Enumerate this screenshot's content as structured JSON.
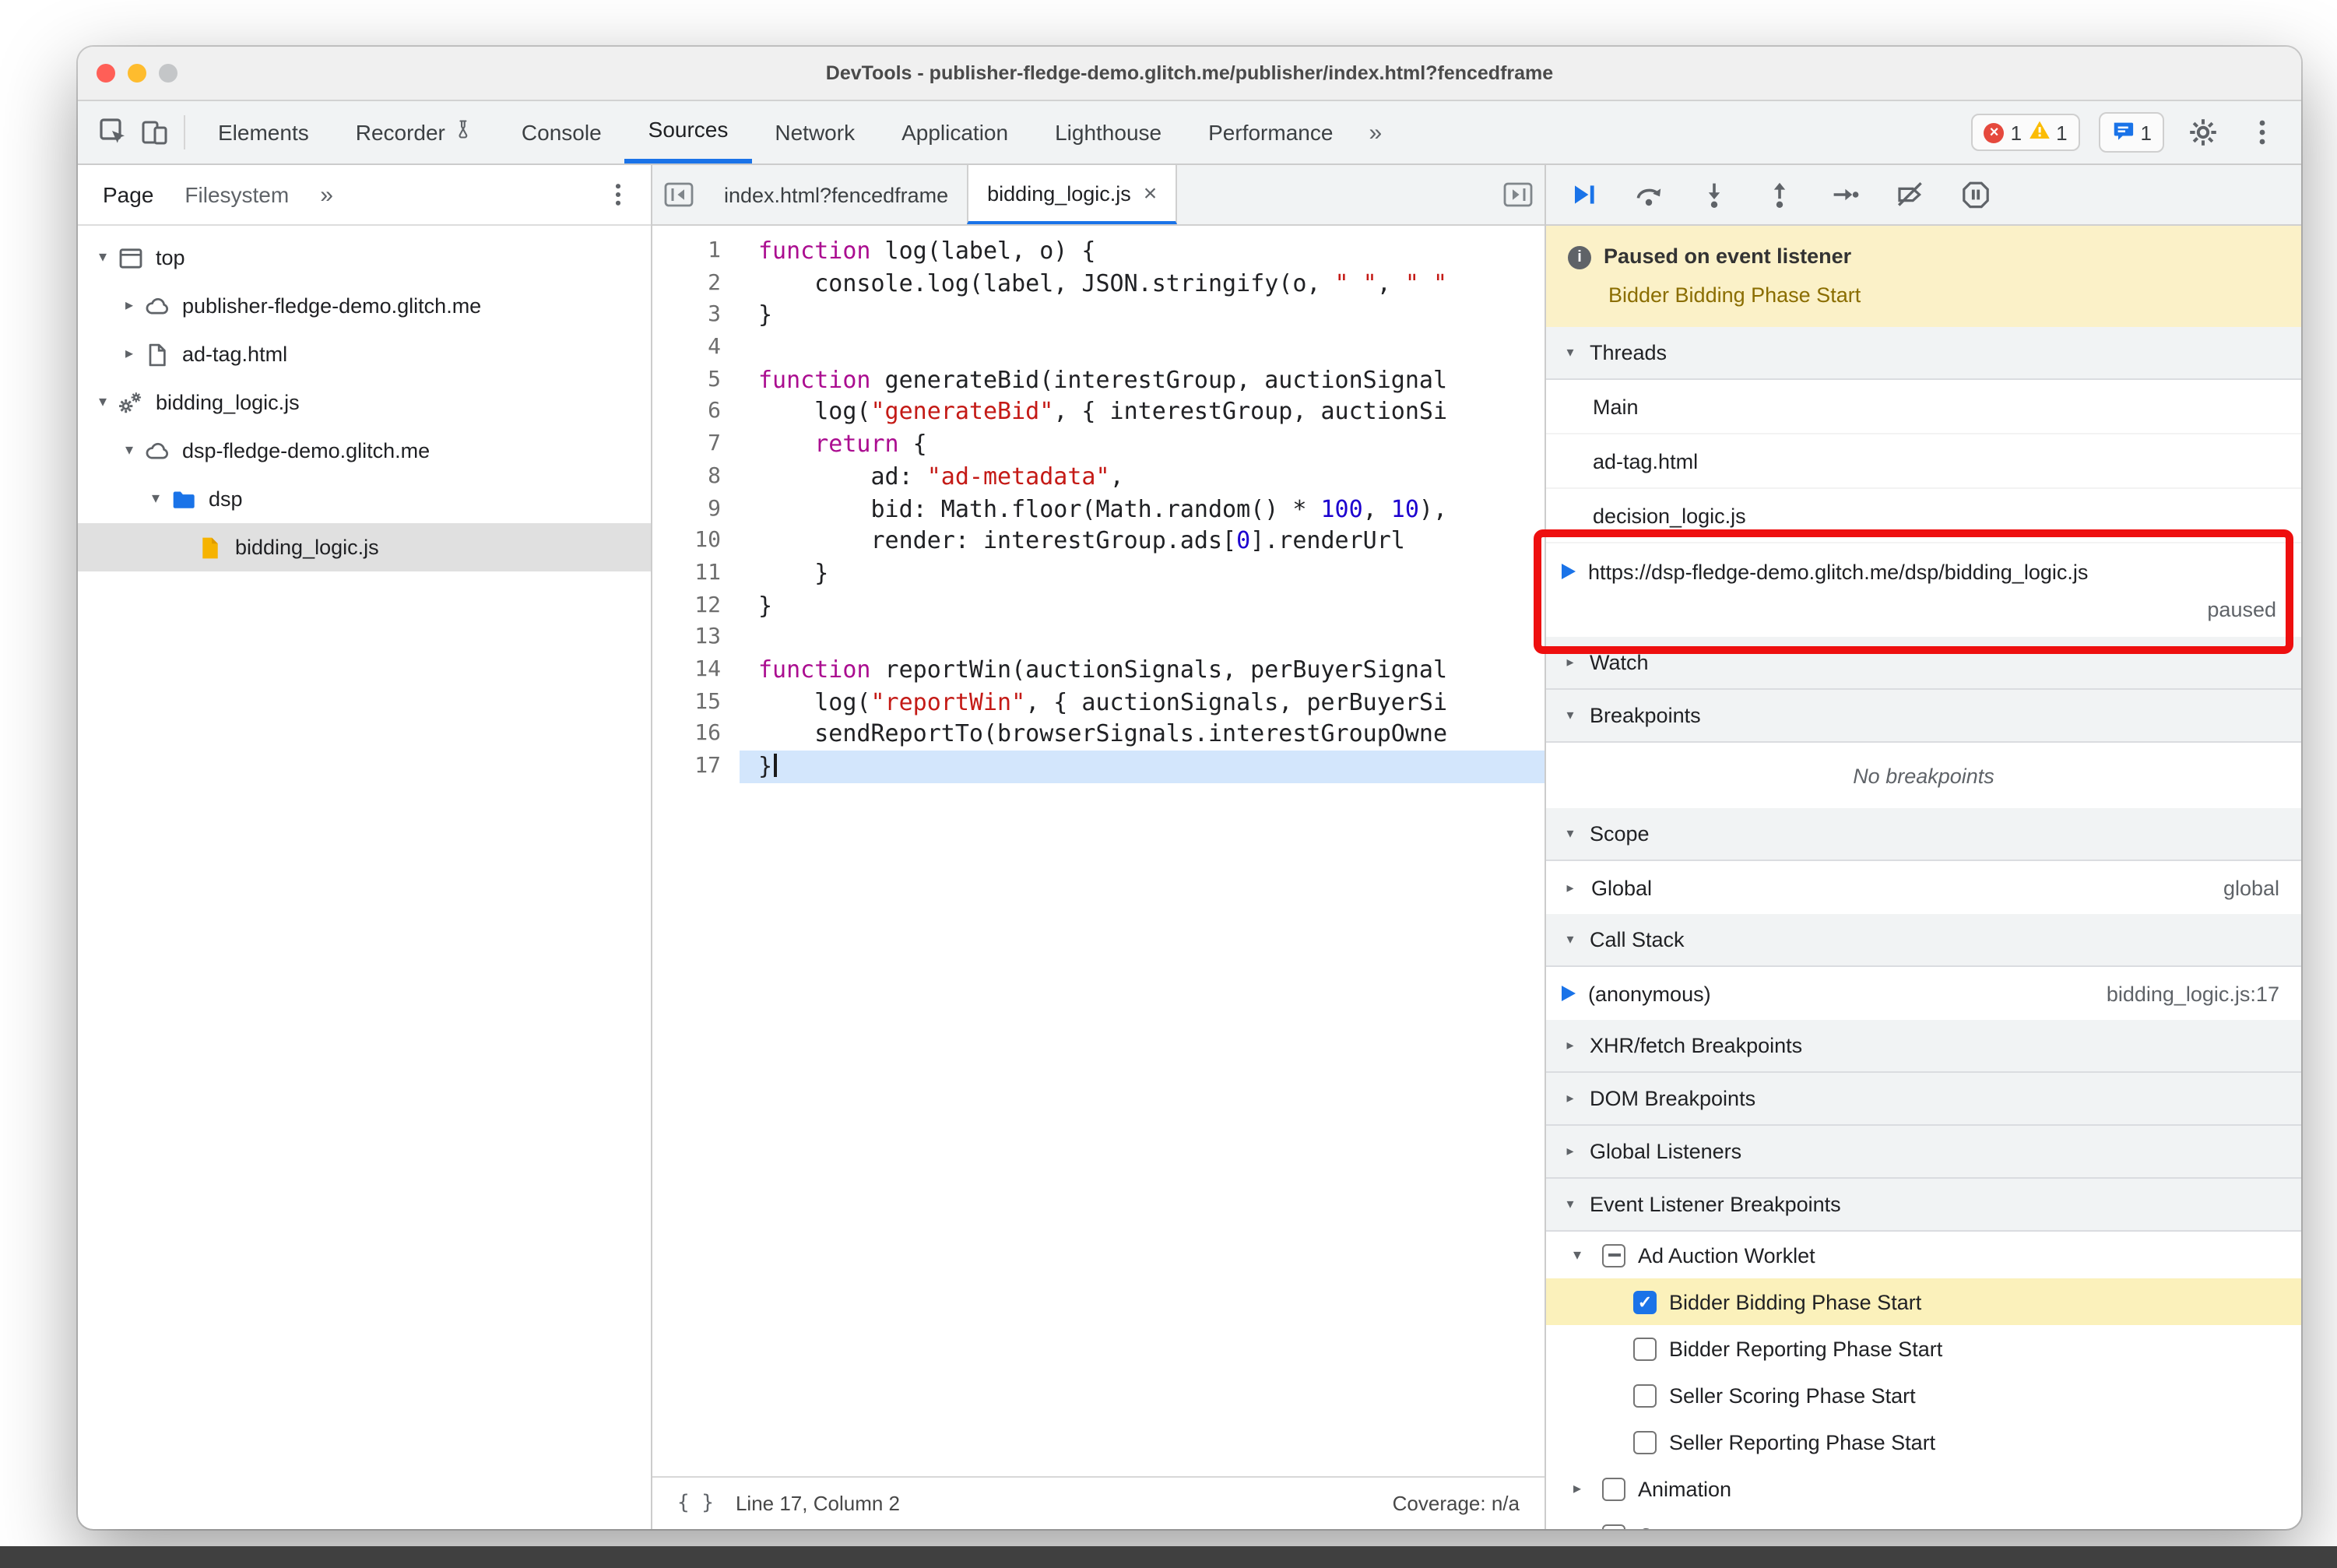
{
  "window": {
    "title": "DevTools - publisher-fledge-demo.glitch.me/publisher/index.html?fencedframe"
  },
  "toolbar": {
    "panel_tabs": [
      {
        "label": "Elements"
      },
      {
        "label": "Recorder",
        "has_experiment_icon": true
      },
      {
        "label": "Console"
      },
      {
        "label": "Sources",
        "active": true
      },
      {
        "label": "Network"
      },
      {
        "label": "Application"
      },
      {
        "label": "Lighthouse"
      },
      {
        "label": "Performance"
      }
    ],
    "more_label": "»",
    "errors_count": "1",
    "warnings_count": "1",
    "issues_count": "1"
  },
  "navigator": {
    "tabs": [
      "Page",
      "Filesystem"
    ],
    "more_label": "»",
    "tree": [
      {
        "label": "top",
        "icon": "frame-icon",
        "expanded": true,
        "depth": 0
      },
      {
        "label": "publisher-fledge-demo.glitch.me",
        "icon": "cloud-icon",
        "expanded": false,
        "depth": 1
      },
      {
        "label": "ad-tag.html",
        "icon": "document-icon",
        "expanded": false,
        "depth": 1
      },
      {
        "label": "bidding_logic.js",
        "icon": "worklet-icon",
        "expanded": true,
        "depth": 0
      },
      {
        "label": "dsp-fledge-demo.glitch.me",
        "icon": "cloud-icon",
        "expanded": true,
        "depth": 1
      },
      {
        "label": "dsp",
        "icon": "folder-icon",
        "expanded": true,
        "depth": 2
      },
      {
        "label": "bidding_logic.js",
        "icon": "js-file-icon",
        "expanded": null,
        "depth": 3,
        "selected": true
      }
    ]
  },
  "editor": {
    "tabs": [
      {
        "label": "index.html?fencedframe"
      },
      {
        "label": "bidding_logic.js",
        "active": true,
        "closable": true
      }
    ],
    "current_line": 17,
    "lines": [
      {
        "n": 1,
        "tokens": [
          [
            "k",
            "function"
          ],
          [
            "p",
            " log(label, o) {"
          ]
        ]
      },
      {
        "n": 2,
        "tokens": [
          [
            "p",
            "    console.log(label, JSON.stringify(o, "
          ],
          [
            "s",
            "\" \""
          ],
          [
            "p",
            ", "
          ],
          [
            "s",
            "\" \""
          ]
        ]
      },
      {
        "n": 3,
        "tokens": [
          [
            "p",
            "}"
          ]
        ]
      },
      {
        "n": 4,
        "tokens": []
      },
      {
        "n": 5,
        "tokens": [
          [
            "k",
            "function"
          ],
          [
            "p",
            " generateBid(interestGroup, auctionSignal"
          ]
        ]
      },
      {
        "n": 6,
        "tokens": [
          [
            "p",
            "    log("
          ],
          [
            "s",
            "\"generateBid\""
          ],
          [
            "p",
            ", { interestGroup, auctionSi"
          ]
        ]
      },
      {
        "n": 7,
        "tokens": [
          [
            "p",
            "    "
          ],
          [
            "k",
            "return"
          ],
          [
            "p",
            " {"
          ]
        ]
      },
      {
        "n": 8,
        "tokens": [
          [
            "p",
            "        ad: "
          ],
          [
            "s",
            "\"ad-metadata\""
          ],
          [
            "p",
            ","
          ]
        ]
      },
      {
        "n": 9,
        "tokens": [
          [
            "p",
            "        bid: Math.floor(Math.random() * "
          ],
          [
            "n",
            "100"
          ],
          [
            "p",
            ", "
          ],
          [
            "n",
            "10"
          ],
          [
            "p",
            "),"
          ]
        ]
      },
      {
        "n": 10,
        "tokens": [
          [
            "p",
            "        render: interestGroup.ads["
          ],
          [
            "n",
            "0"
          ],
          [
            "p",
            "].renderUrl"
          ]
        ]
      },
      {
        "n": 11,
        "tokens": [
          [
            "p",
            "    }"
          ]
        ]
      },
      {
        "n": 12,
        "tokens": [
          [
            "p",
            "}"
          ]
        ]
      },
      {
        "n": 13,
        "tokens": []
      },
      {
        "n": 14,
        "tokens": [
          [
            "k",
            "function"
          ],
          [
            "p",
            " reportWin(auctionSignals, perBuyerSignal"
          ]
        ]
      },
      {
        "n": 15,
        "tokens": [
          [
            "p",
            "    log("
          ],
          [
            "s",
            "\"reportWin\""
          ],
          [
            "p",
            ", { auctionSignals, perBuyerSi"
          ]
        ]
      },
      {
        "n": 16,
        "tokens": [
          [
            "p",
            "    sendReportTo(browserSignals.interestGroupOwne"
          ]
        ]
      },
      {
        "n": 17,
        "tokens": [
          [
            "p",
            "}"
          ]
        ]
      }
    ],
    "status": {
      "format_label": "{ }",
      "position": "Line 17, Column 2",
      "coverage": "Coverage: n/a"
    }
  },
  "debugger": {
    "toolbar_icons": [
      "resume-icon",
      "step-over-icon",
      "step-into-icon",
      "step-out-icon",
      "step-icon",
      "deactivate-breakpoints-icon",
      "pause-on-exceptions-icon"
    ],
    "paused_banner": {
      "title": "Paused on event listener",
      "subtitle": "Bidder Bidding Phase Start"
    },
    "sections": {
      "threads": {
        "title": "Threads",
        "expanded": true,
        "items": [
          {
            "label": "Main"
          },
          {
            "label": "ad-tag.html"
          },
          {
            "label": "decision_logic.js"
          },
          {
            "label": "https://dsp-fledge-demo.glitch.me/dsp/bidding_logic.js",
            "active": true,
            "status": "paused"
          }
        ]
      },
      "watch": {
        "title": "Watch",
        "expanded": false
      },
      "breakpoints": {
        "title": "Breakpoints",
        "expanded": true,
        "empty_text": "No breakpoints"
      },
      "scope": {
        "title": "Scope",
        "expanded": true,
        "items": [
          {
            "label": "Global",
            "value": "global",
            "expanded": false
          }
        ]
      },
      "call_stack": {
        "title": "Call Stack",
        "expanded": true,
        "frames": [
          {
            "label": "(anonymous)",
            "location": "bidding_logic.js:17",
            "active": true
          }
        ]
      },
      "xhr_breakpoints": {
        "title": "XHR/fetch Breakpoints",
        "expanded": false
      },
      "dom_breakpoints": {
        "title": "DOM Breakpoints",
        "expanded": false
      },
      "global_listeners": {
        "title": "Global Listeners",
        "expanded": false
      },
      "event_listener_breakpoints": {
        "title": "Event Listener Breakpoints",
        "expanded": true,
        "groups": [
          {
            "label": "Ad Auction Worklet",
            "checkbox": "indeterminate",
            "expanded": true,
            "children": [
              {
                "label": "Bidder Bidding Phase Start",
                "checkbox": "checked",
                "highlighted": true
              },
              {
                "label": "Bidder Reporting Phase Start",
                "checkbox": "unchecked"
              },
              {
                "label": "Seller Scoring Phase Start",
                "checkbox": "unchecked"
              },
              {
                "label": "Seller Reporting Phase Start",
                "checkbox": "unchecked"
              }
            ]
          },
          {
            "label": "Animation",
            "checkbox": "unchecked",
            "expanded": false
          },
          {
            "label": "Canvas",
            "checkbox": "unchecked",
            "expanded": false
          }
        ]
      }
    }
  },
  "annotation": {
    "shape": "red-box",
    "around": "paused thread https://dsp-fledge-demo.glitch.me/dsp/bidding_logic.js"
  },
  "colors": {
    "accent": "#1a73e8",
    "annotation_red": "#ee0f0f",
    "execution_line_blue": "#d3e6fc",
    "breakpoint_hit_yellow": "#fbf1bb",
    "banner_yellow": "#fbf1c8",
    "error_red": "#e5493d",
    "warning_yellow": "#fbbc04",
    "syntax_keyword": "#ab0d90",
    "syntax_string": "#c41a16",
    "syntax_number": "#1c00cf"
  }
}
